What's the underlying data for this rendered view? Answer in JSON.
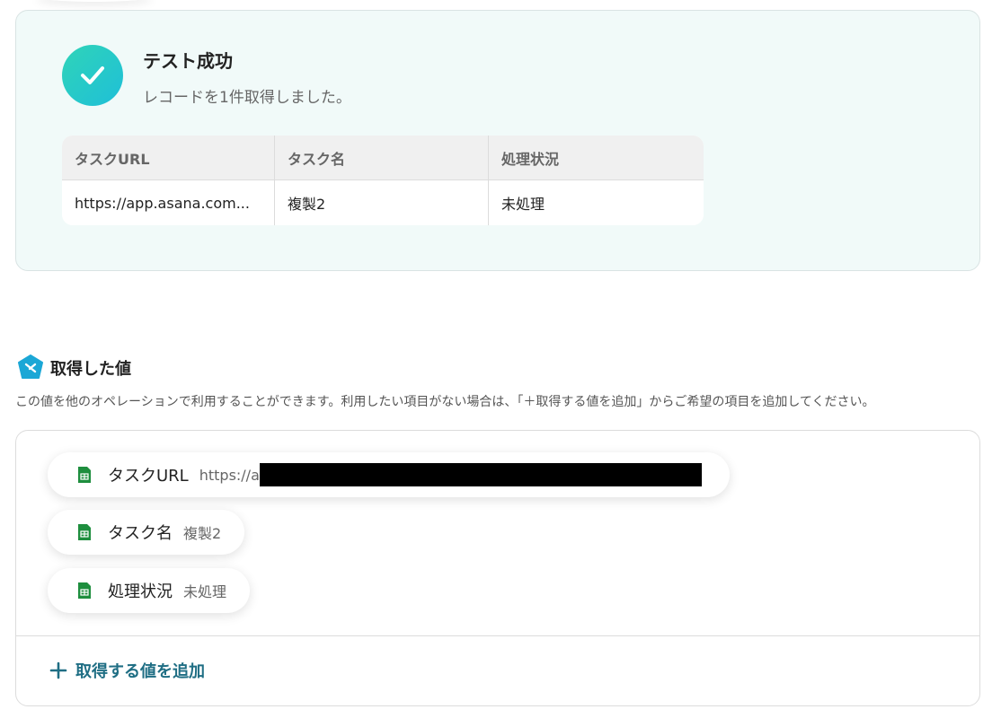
{
  "success": {
    "title": "テスト成功",
    "subtitle": "レコードを1件取得しました。",
    "table": {
      "headers": [
        "タスクURL",
        "タスク名",
        "処理状況"
      ],
      "row": [
        "https://app.asana.com...",
        "複製2",
        "未処理"
      ]
    }
  },
  "section": {
    "title": "取得した値",
    "description": "この値を他のオペレーションで利用することができます。利用したい項目がない場合は、「＋取得する値を追加」からご希望の項目を追加してください。"
  },
  "values": [
    {
      "label": "タスクURL",
      "value": "https://a"
    },
    {
      "label": "タスク名",
      "value": "複製2"
    },
    {
      "label": "処理状況",
      "value": "未処理"
    }
  ],
  "add_button": {
    "label": "取得する値を追加"
  },
  "colors": {
    "accent": "#1f6e84",
    "success": "#2fd4b8",
    "sheets_green": "#1e8e3e"
  }
}
